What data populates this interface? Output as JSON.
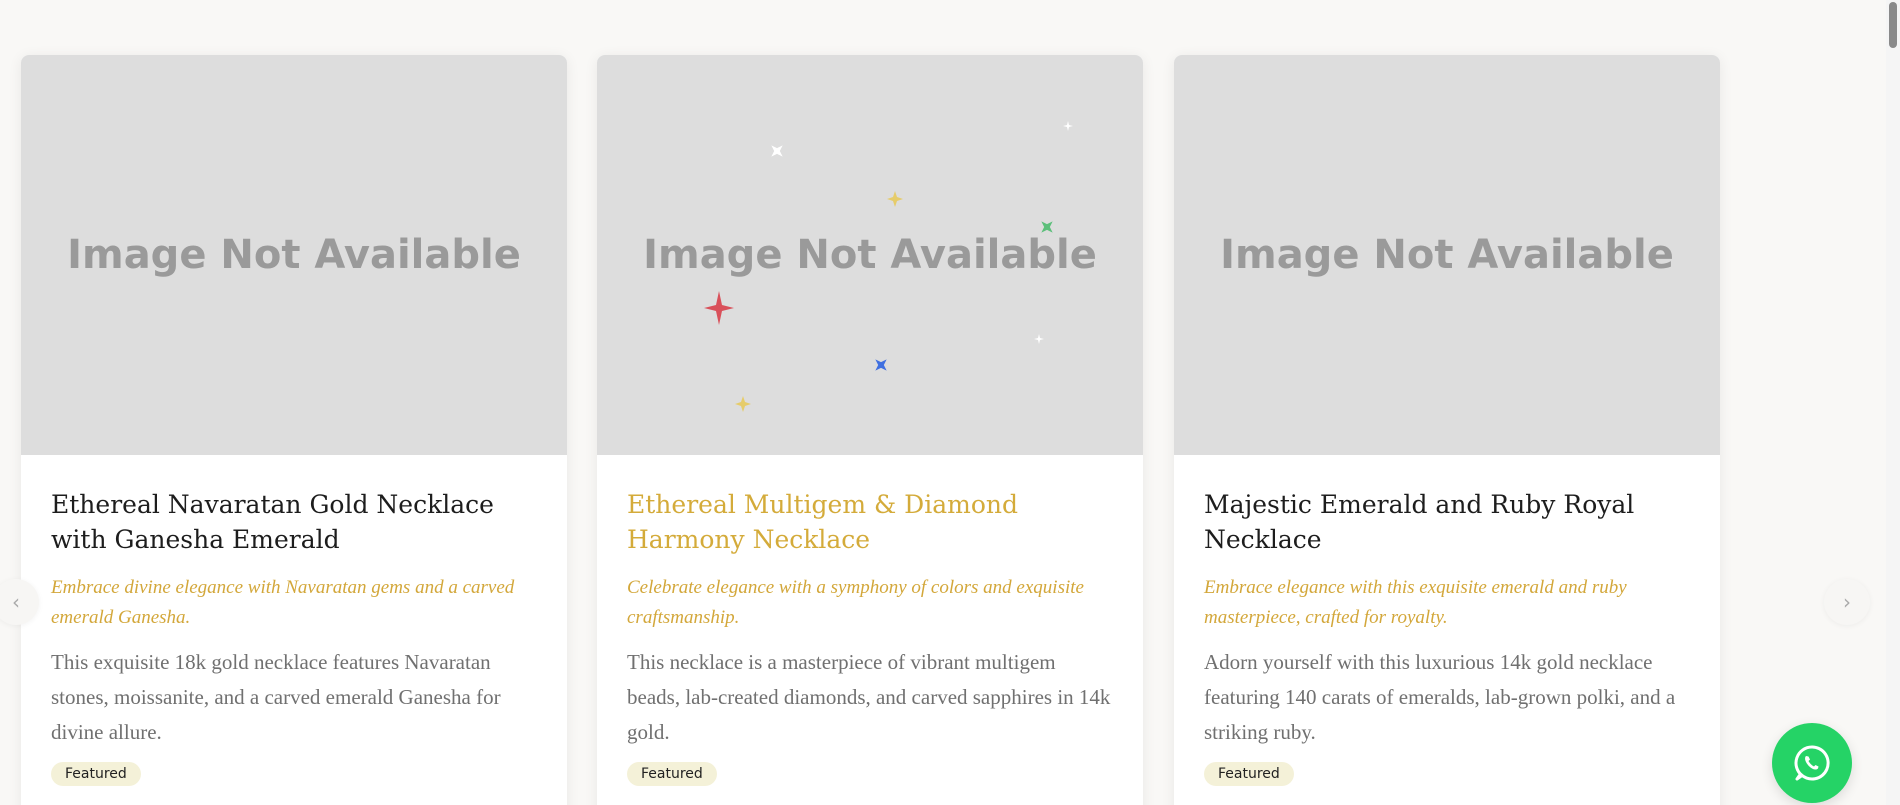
{
  "products": [
    {
      "image_placeholder": "Image Not Available",
      "title": "Ethereal Navaratan Gold Necklace with Ganesha Emerald",
      "tagline": "Embrace divine elegance with Navaratan gems and a carved emerald Ganesha.",
      "description": "This exquisite 18k gold necklace features Navaratan stones, moissanite, and a carved emerald Ganesha for divine allure.",
      "badge": "Featured"
    },
    {
      "image_placeholder": "Image Not Available",
      "title": "Ethereal Multigem & Diamond Harmony Necklace",
      "tagline": "Celebrate elegance with a symphony of colors and exquisite craftsmanship.",
      "description": "This necklace is a masterpiece of vibrant multigem beads, lab-created diamonds, and carved sapphires in 14k gold.",
      "badge": "Featured"
    },
    {
      "image_placeholder": "Image Not Available",
      "title": "Majestic Emerald and Ruby Royal Necklace",
      "tagline": "Embrace elegance with this exquisite emerald and ruby masterpiece, crafted for royalty.",
      "description": "Adorn yourself with this luxurious 14k gold necklace featuring 140 carats of emeralds, lab-grown polki, and a striking ruby.",
      "badge": "Featured"
    }
  ],
  "carousel": {
    "prev_icon": "chevron-left-icon",
    "next_icon": "chevron-right-icon"
  },
  "whatsapp": {
    "icon": "whatsapp-icon"
  },
  "colors": {
    "gold_accent": "#d4ab3a",
    "whatsapp_green": "#25d366",
    "badge_bg": "#f4f1d8",
    "page_bg": "#f9f8f6"
  }
}
